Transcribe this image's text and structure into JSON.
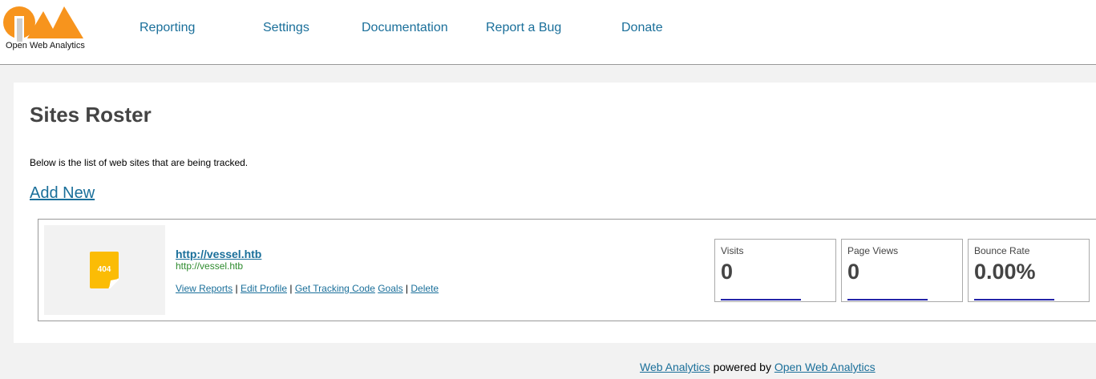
{
  "header": {
    "logo_text": "Open Web Analytics",
    "nav": [
      {
        "label": "Reporting"
      },
      {
        "label": "Settings"
      },
      {
        "label": "Documentation"
      },
      {
        "label": "Report a Bug"
      },
      {
        "label": "Donate"
      }
    ]
  },
  "main": {
    "title": "Sites Roster",
    "description": "Below is the list of web sites that are being tracked.",
    "add_new": "Add New",
    "site": {
      "thumbnail_text": "404",
      "name": "http://vessel.htb",
      "url": "http://vessel.htb",
      "actions": {
        "view_reports": "View Reports",
        "edit_profile": "Edit Profile",
        "get_tracking_code": "Get Tracking Code",
        "goals": "Goals",
        "delete": "Delete",
        "separator": "|"
      },
      "metrics": [
        {
          "label": "Visits",
          "value": "0"
        },
        {
          "label": "Page Views",
          "value": "0"
        },
        {
          "label": "Bounce Rate",
          "value": "0.00%"
        }
      ]
    }
  },
  "footer": {
    "link1": "Web Analytics",
    "middle": "powered by",
    "link2": "Open Web Analytics"
  },
  "colors": {
    "link": "#1a6f9a",
    "logo_orange": "#f7941d",
    "site_url_green": "#2e8b2e",
    "thumb_yellow": "#fbbc05",
    "sparkline": "#2323a8"
  }
}
